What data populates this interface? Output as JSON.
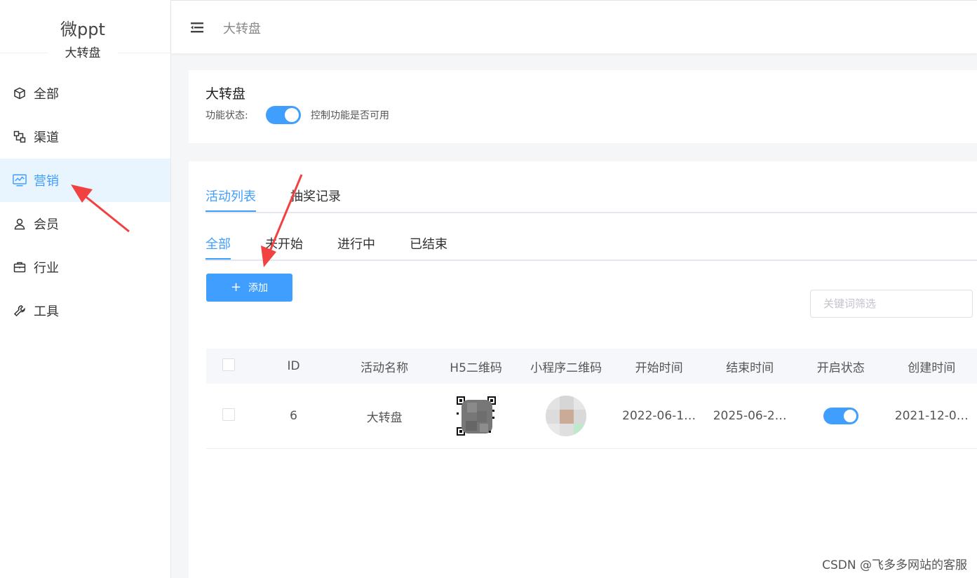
{
  "brand": {
    "name": "微ppt",
    "subtitle": "大转盘"
  },
  "sidebar": {
    "items": [
      {
        "label": "全部",
        "icon": "cube-icon"
      },
      {
        "label": "渠道",
        "icon": "channel-icon"
      },
      {
        "label": "营销",
        "icon": "chart-monitor-icon",
        "active": true
      },
      {
        "label": "会员",
        "icon": "user-icon"
      },
      {
        "label": "行业",
        "icon": "briefcase-icon"
      },
      {
        "label": "工具",
        "icon": "wrench-icon"
      }
    ]
  },
  "header": {
    "breadcrumb": "大转盘"
  },
  "feature": {
    "title": "大转盘",
    "status_label": "功能状态:",
    "enabled": true,
    "hint": "控制功能是否可用"
  },
  "tabs": {
    "primary": [
      "活动列表",
      "抽奖记录"
    ],
    "primary_active": "活动列表",
    "secondary": [
      "全部",
      "未开始",
      "进行中",
      "已结束"
    ],
    "secondary_active": "全部"
  },
  "toolbar": {
    "add_label": "添加",
    "search_placeholder": "关键词筛选"
  },
  "table": {
    "columns": [
      "ID",
      "活动名称",
      "H5二维码",
      "小程序二维码",
      "开始时间",
      "结束时间",
      "开启状态",
      "创建时间"
    ],
    "rows": [
      {
        "id": "6",
        "name": "大转盘",
        "start": "2022-06-1…",
        "end": "2025-06-2…",
        "enabled": true,
        "created": "2021-12-0…"
      }
    ]
  },
  "watermark": "CSDN @飞多多网站的客服",
  "colors": {
    "primary": "#409eff",
    "annotation": "#f24141",
    "active_bg": "#e8f4fe"
  }
}
